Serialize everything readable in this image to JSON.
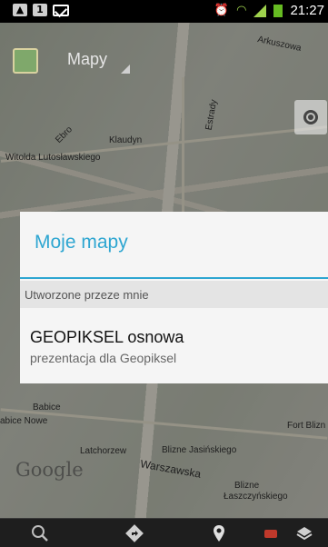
{
  "status_bar": {
    "time": "21:27",
    "notification_icons": [
      "image-icon",
      "sim-icon",
      "mail-icon"
    ],
    "status_icons": [
      "alarm-icon",
      "wifi-icon",
      "signal-icon",
      "battery-icon"
    ]
  },
  "action_bar": {
    "title": "Mapy"
  },
  "map": {
    "labels": {
      "arkuszowa": "Arkuszowa",
      "estrady": "Estrady",
      "ebro": "Ebro",
      "klaudyn": "Klaudyn",
      "lutoslawskiego": "Witolda Lutosławskiego",
      "babice": "Babice",
      "babice_nowe": "abice Nowe",
      "fort_blizne": "Fort Blizn",
      "latchorzew": "Latchorzew",
      "blizne_jasinskiego": "Blizne Jasińskiego",
      "warszawska": "Warszawska",
      "blizne": "Blizne",
      "laszczynskiego": "Łaszczyńskiego"
    },
    "google": "Google"
  },
  "dialog": {
    "title": "Moje mapy",
    "section_header": "Utworzone przeze mnie",
    "items": [
      {
        "title": "GEOPIKSEL osnowa",
        "subtitle": "prezentacja dla Geopiksel"
      }
    ]
  },
  "bottom_bar": {
    "icons": [
      "search-icon",
      "directions-icon",
      "place-icon",
      "latitude-icon",
      "layers-icon"
    ]
  },
  "colors": {
    "accent": "#2ea6d1",
    "dialog_bg": "#f5f5f5"
  }
}
